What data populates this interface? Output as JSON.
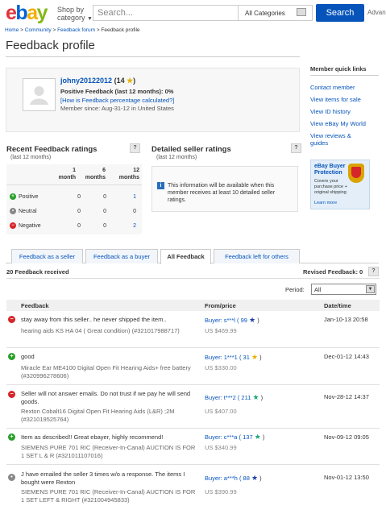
{
  "header": {
    "logo": {
      "e": "e",
      "b": "b",
      "a": "a",
      "y": "y",
      "colors": [
        "#e53238",
        "#0064d2",
        "#f5af02",
        "#86b817"
      ]
    },
    "shop_by": "Shop by",
    "category": "category",
    "search_placeholder": "Search...",
    "category_select": "All Categories",
    "search_button": "Search",
    "advanced": "Advan"
  },
  "breadcrumb": [
    "Home",
    "Community",
    "Feedback forum",
    "Feedback profile"
  ],
  "page_title": "Feedback profile",
  "profile": {
    "username": "johny20122012",
    "score": "14",
    "positive": "Positive Feedback (last 12 months): 0%",
    "how_link": "[How is Feedback percentage calculated?]",
    "member_since": "Member since: Aug-31-12 in United States"
  },
  "quick_links": {
    "title": "Member quick links",
    "items": [
      "Contact member",
      "View items for sale",
      "View ID history",
      "View eBay My World",
      "View reviews &",
      "guides"
    ]
  },
  "recent": {
    "title": "Recent Feedback ratings",
    "subtitle": "(last 12 months)",
    "help": "?",
    "cols": [
      "1",
      "month",
      "6",
      "months",
      "12",
      "months"
    ],
    "rows": [
      {
        "label": "Positive",
        "v1": "0",
        "v6": "0",
        "v12": "1"
      },
      {
        "label": "Neutral",
        "v1": "0",
        "v6": "0",
        "v12": "0"
      },
      {
        "label": "Negative",
        "v1": "0",
        "v6": "0",
        "v12": "2"
      }
    ]
  },
  "detailed": {
    "title": "Detailed seller ratings",
    "subtitle": "(last 12 months)",
    "help": "?",
    "info": "This information will be available when this member receives at least 10 detailed seller ratings."
  },
  "ad": {
    "title1": "eBay Buyer",
    "title2": "Protection",
    "line1": "Covers your",
    "line2": "purchase price +",
    "line3": "original shipping",
    "link": "Learn more"
  },
  "tabs": [
    "Feedback as a seller",
    "Feedback as a buyer",
    "All Feedback",
    "Feedback left for others"
  ],
  "summary": {
    "count": "20 Feedback received",
    "revised": "Revised Feedback: 0",
    "help": "?"
  },
  "period": {
    "label": "Period:",
    "value": "All"
  },
  "table_headers": {
    "feedback": "Feedback",
    "from": "From/price",
    "date": "Date/time"
  },
  "feedback": [
    {
      "type": "neg",
      "text": "stay away from this seller.. he never shipped the item..",
      "item": "hearing aids KS HA 04 ( Great condition) (#321017988717)",
      "buyer": "Buyer: s***l ( 99",
      "star": "blue",
      "price": "US $469.99",
      "date": "Jan-10-13 20:58"
    },
    {
      "type": "pos",
      "text": "good",
      "item": "Miracle Ear ME4100 Digital Open Fit Hearing Aids+ free battery (#320996278606)",
      "buyer": "Buyer: 1***1 ( 31",
      "star": "yellow",
      "price": "US $330.00",
      "date": "Dec-01-12 14:43"
    },
    {
      "type": "neg",
      "text": "Seller will not answer emails. Do not trust if we pay he will send goods.",
      "item": "Rexton Cobalt16 Digital Open Fit Hearing Aids (L&R) ;2M (#321019525764)",
      "buyer": "Buyer: t***2 ( 211",
      "star": "teal",
      "price": "US $407.00",
      "date": "Nov-28-12 14:37"
    },
    {
      "type": "pos",
      "text": "Item as described!! Great ebayer, highly recommend!",
      "item": "SIEMENS PURE 701 RIC (Receiver-In-Canal) AUCTION IS FOR 1 SET L & R (#321011107016)",
      "buyer": "Buyer: c***a ( 137",
      "star": "teal",
      "price": "US $340.99",
      "date": "Nov-09-12 09:05"
    },
    {
      "type": "neu",
      "text": "J have emailed the seller 3 times w/o a response. The items I bought were Rexton",
      "item": "SIEMENS PURE 701 RIC (Receiver-In-Canal) AUCTION IS FOR 1 SET LEFT & RIGHT (#321004945833)",
      "buyer": "Buyer: a***h ( 88",
      "star": "blue",
      "price": "US $390.99",
      "date": "Nov-01-12 13:50"
    }
  ]
}
